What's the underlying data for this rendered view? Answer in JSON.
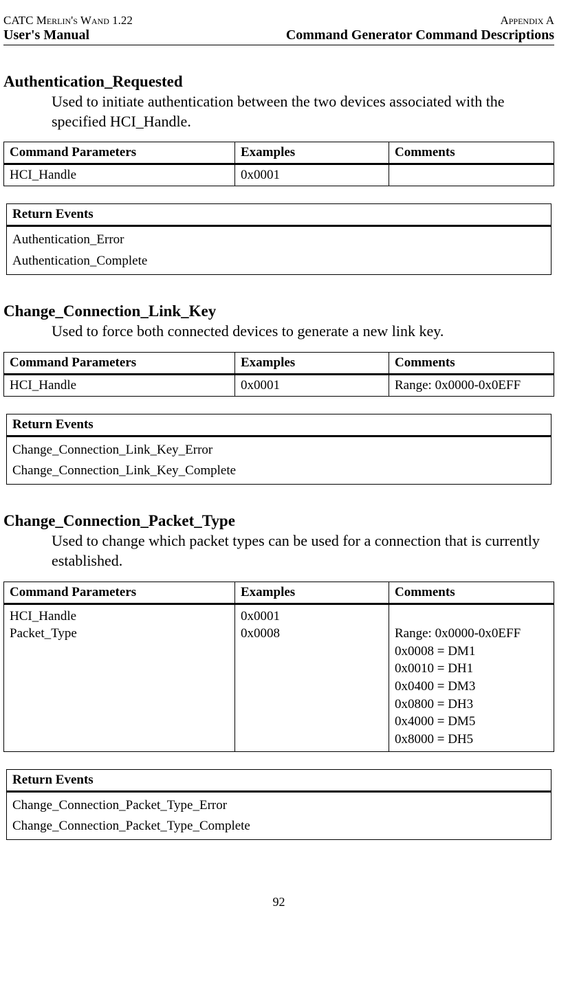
{
  "header": {
    "topLeft": "CATC Merlin's Wand 1.22",
    "topRight": "Appendix A",
    "botLeft": "User's Manual",
    "botRight": "Command Generator Command Descriptions"
  },
  "sections": [
    {
      "title": "Authentication_Requested",
      "desc": "Used to initiate authentication between the two devices associated with the specified HCI_Handle.",
      "paramHeaders": [
        "Command Parameters",
        "Examples",
        "Comments"
      ],
      "paramRows": [
        {
          "p": "HCI_Handle",
          "e": "0x0001",
          "c": ""
        }
      ],
      "eventsHeader": "Return Events",
      "events": "Authentication_Error\nAuthentication_Complete"
    },
    {
      "title": "Change_Connection_Link_Key",
      "desc": "Used to force both connected devices to generate a new link key.",
      "paramHeaders": [
        "Command Parameters",
        "Examples",
        "Comments"
      ],
      "paramRows": [
        {
          "p": "HCI_Handle",
          "e": "0x0001",
          "c": "Range: 0x0000-0x0EFF"
        }
      ],
      "eventsHeader": "Return Events",
      "events": "Change_Connection_Link_Key_Error\nChange_Connection_Link_Key_Complete"
    },
    {
      "title": "Change_Connection_Packet_Type",
      "desc": "Used to change which packet types can be used for a connection that is currently established.",
      "paramHeaders": [
        "Command Parameters",
        "Examples",
        "Comments"
      ],
      "paramRows": [
        {
          "p": "HCI_Handle\nPacket_Type",
          "e": "0x0001\n0x0008",
          "c": "\nRange: 0x0000-0x0EFF\n0x0008 = DM1\n0x0010 = DH1\n0x0400 = DM3\n0x0800 = DH3\n0x4000 = DM5\n0x8000 = DH5"
        }
      ],
      "eventsHeader": "Return Events",
      "events": "Change_Connection_Packet_Type_Error\nChange_Connection_Packet_Type_Complete"
    }
  ],
  "pageNumber": "92"
}
